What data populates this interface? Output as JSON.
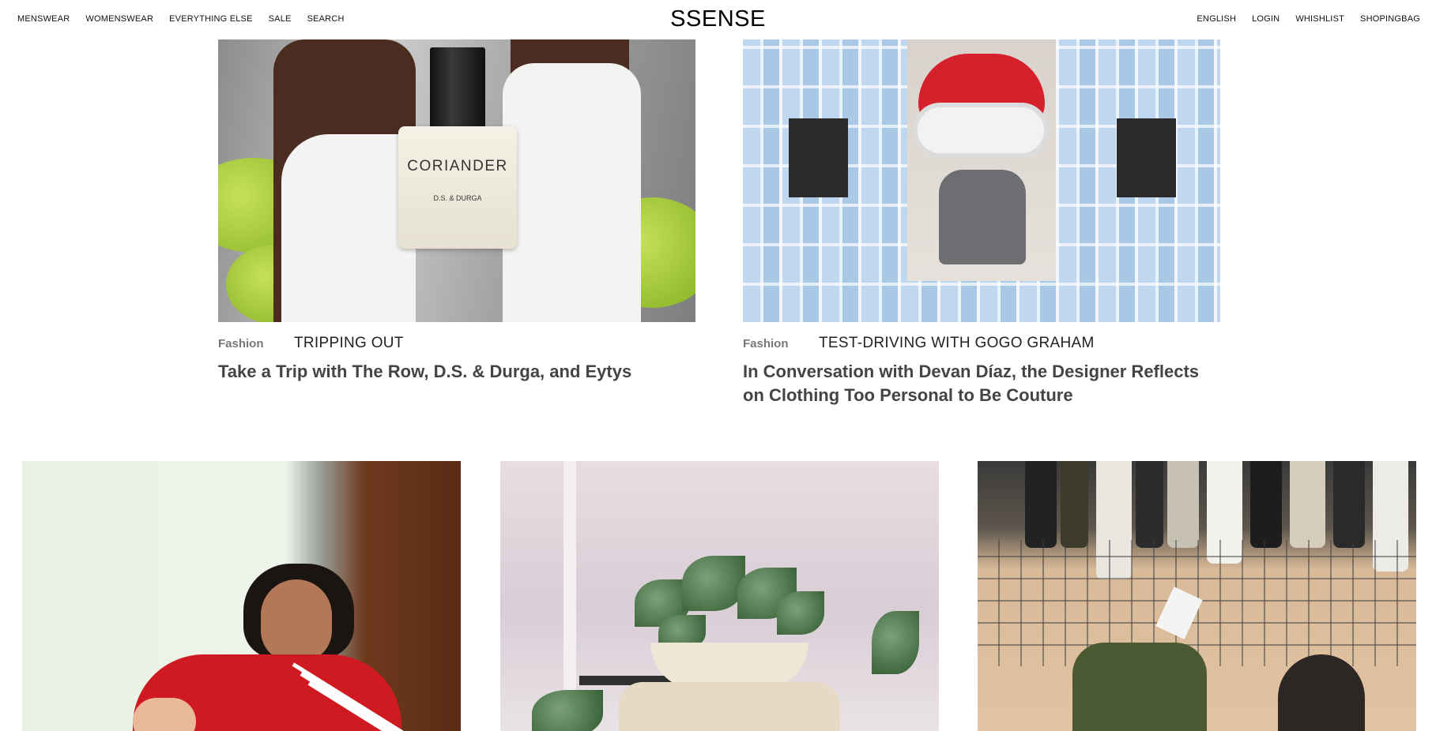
{
  "header": {
    "logo": "SSENSE",
    "nav_left": [
      "MENSWEAR",
      "WOMENSWEAR",
      "EVERYTHING ELSE",
      "SALE",
      "SEARCH"
    ],
    "nav_right": [
      "ENGLISH",
      "LOGIN",
      "WHISHLIST",
      "SHOPINGBAG"
    ]
  },
  "features": [
    {
      "category": "Fashion",
      "series": "TRIPPING OUT",
      "headline": "Take a Trip with The Row, D.S. & Durga, and Eytys",
      "image_text": {
        "label": "CORIANDER",
        "sublabel": "D.S. & DURGA"
      }
    },
    {
      "category": "Fashion",
      "series": "TEST-DRIVING WITH GOGO GRAHAM",
      "headline": "In Conversation with Devan Díaz, the Designer Reflects on Clothing Too Personal to Be Couture"
    }
  ],
  "colors": {
    "background": "#ffffff",
    "text": "#222222",
    "muted": "#777777"
  }
}
